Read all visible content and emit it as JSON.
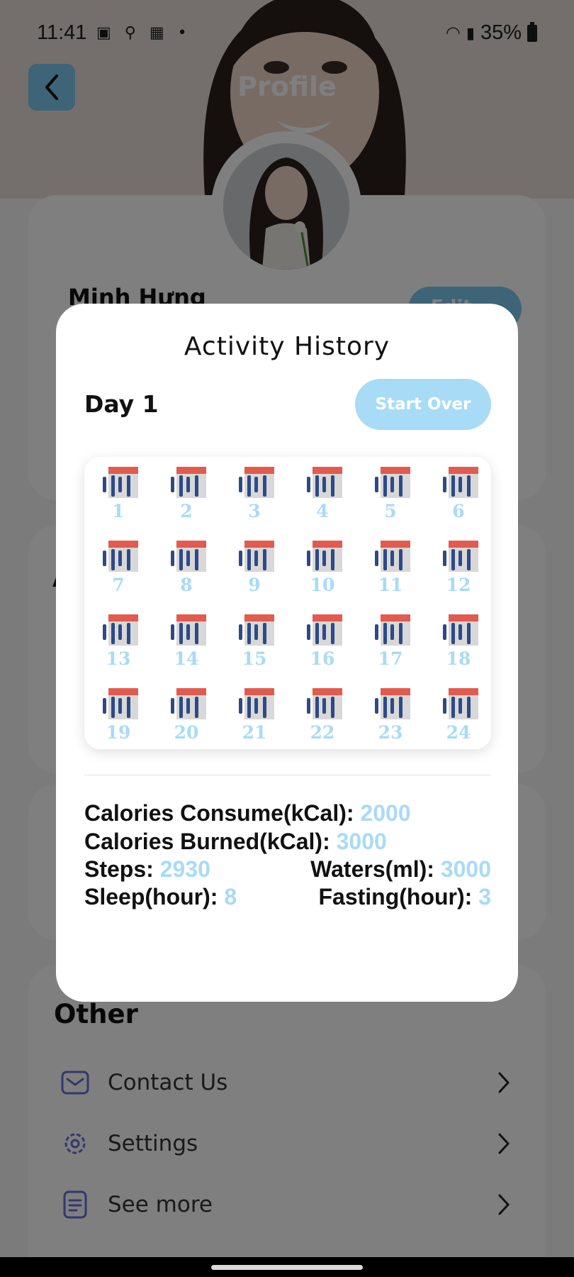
{
  "status_bar": {
    "time": "11:41",
    "battery": "35%"
  },
  "header": {
    "title": "Profile"
  },
  "profile": {
    "name": "Minh Hưng",
    "edit_label": "Edit"
  },
  "other_section": {
    "title": "Other",
    "items": [
      {
        "label": "Contact Us",
        "icon": "mail-icon"
      },
      {
        "label": "Settings",
        "icon": "gear-icon"
      },
      {
        "label": "See more",
        "icon": "document-icon"
      }
    ]
  },
  "modal": {
    "title": "Activity History",
    "day_label": "Day 1",
    "start_over_label": "Start Over",
    "days": [
      "1",
      "2",
      "3",
      "4",
      "5",
      "6",
      "7",
      "8",
      "9",
      "10",
      "11",
      "12",
      "13",
      "14",
      "15",
      "16",
      "17",
      "18",
      "19",
      "20",
      "21",
      "22",
      "23",
      "24"
    ],
    "stats": {
      "calories_consume_label": "Calories Consume(kCal):",
      "calories_consume_value": "2000",
      "calories_burned_label": "Calories Burned(kCal):",
      "calories_burned_value": "3000",
      "steps_label": "Steps:",
      "steps_value": "2930",
      "waters_label": "Waters(ml):",
      "waters_value": "3000",
      "sleep_label": "Sleep(hour):",
      "sleep_value": "8",
      "fasting_label": "Fasting(hour):",
      "fasting_value": "3"
    }
  },
  "colors": {
    "accent": "#a8dbf5",
    "back_button": "#7dc9ef",
    "calendar_top": "#e25b4f",
    "calendar_rings": "#2e4a86",
    "menu_icon": "#6b6fd6"
  }
}
